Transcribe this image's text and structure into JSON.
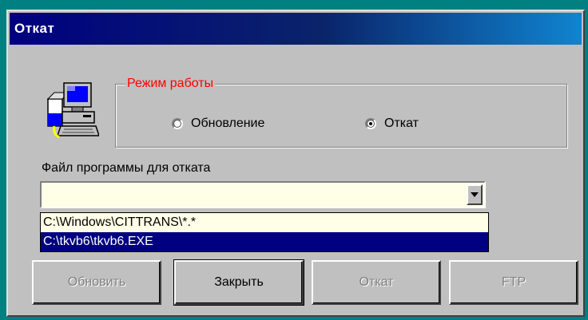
{
  "window": {
    "title": "Откат"
  },
  "mode_group": {
    "title": "Режим работы",
    "options": [
      {
        "label": "Обновление",
        "selected": false
      },
      {
        "label": "Откат",
        "selected": true
      }
    ]
  },
  "file": {
    "label": "Файл программы для отката",
    "value": "",
    "options": [
      {
        "label": "C:\\Windows\\CITTRANS\\*.*",
        "selected": false
      },
      {
        "label": "C:\\tkvb6\\tkvb6.EXE",
        "selected": true
      }
    ]
  },
  "buttons": {
    "update": "Обновить",
    "close": "Закрыть",
    "rollback": "Откат",
    "ftp": "FTP"
  },
  "colors": {
    "title_bar": "#000080",
    "group_title": "#ff0000",
    "selection": "#000080",
    "combo_bg": "#ffffe7"
  }
}
